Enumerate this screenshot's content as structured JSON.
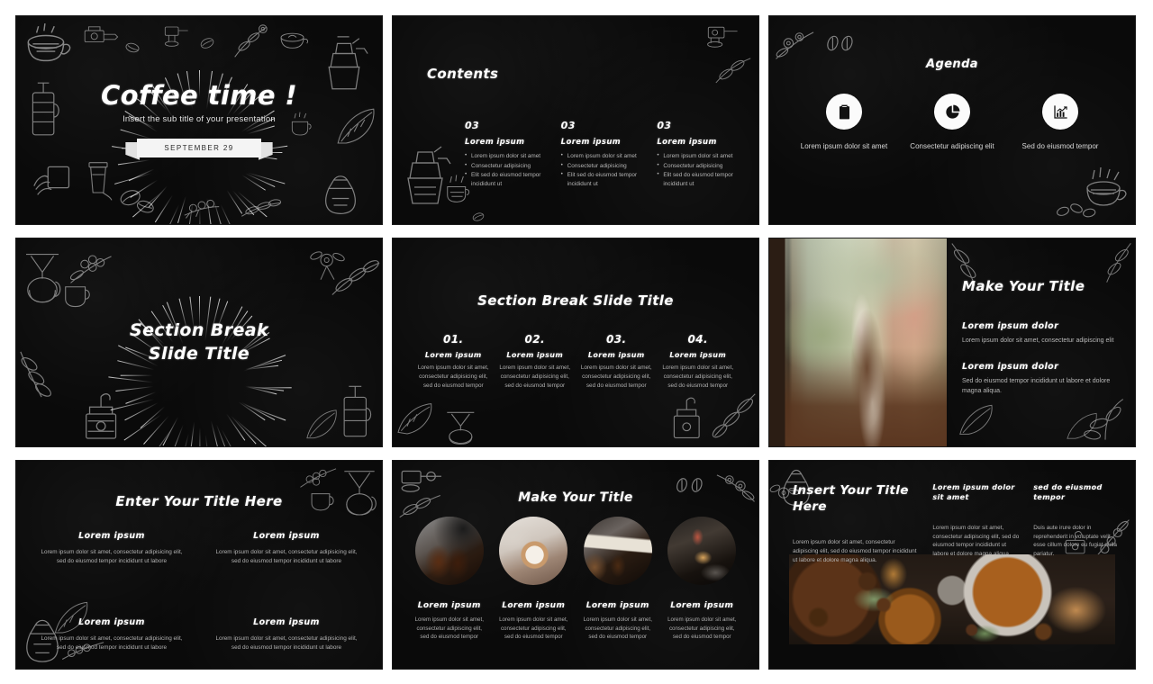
{
  "deck": {
    "theme": {
      "background": "#0a0a0a",
      "text": "#ffffff",
      "muted": "#b5b5b5",
      "accent": "#ffffff"
    }
  },
  "slide1": {
    "title": "Coffee time !",
    "subtitle": "Insert the sub title of your presentation",
    "date_badge": "SEPTEMBER 29"
  },
  "slide2": {
    "heading": "Contents",
    "columns": [
      {
        "number": "03",
        "subtitle": "Lorem ipsum",
        "bullets": [
          "Lorem ipsum dolor sit amet",
          "Consectetur adipisicing",
          "Elit sed do eiusmod tempor incididunt ut"
        ]
      },
      {
        "number": "03",
        "subtitle": "Lorem ipsum",
        "bullets": [
          "Lorem ipsum dolor sit amet",
          "Consectetur adipisicing",
          "Elit sed do eiusmod tempor incididunt ut"
        ]
      },
      {
        "number": "03",
        "subtitle": "Lorem ipsum",
        "bullets": [
          "Lorem ipsum dolor sit amet",
          "Consectetur adipisicing",
          "Elit sed do eiusmod tempor incididunt ut"
        ]
      }
    ]
  },
  "slide3": {
    "heading": "Agenda",
    "items": [
      {
        "icon": "clipboard-checklist-icon",
        "caption": "Lorem ipsum dolor sit amet"
      },
      {
        "icon": "pie-chart-icon",
        "caption": "Consectetur adipiscing elit"
      },
      {
        "icon": "bar-chart-growth-icon",
        "caption": "Sed do eiusmod tempor"
      }
    ]
  },
  "slide4": {
    "title_line1": "Section Break",
    "title_line2": "Slide Title"
  },
  "slide5": {
    "heading": "Section Break Slide Title",
    "columns": [
      {
        "number": "01.",
        "subtitle": "Lorem ipsum",
        "text": "Lorem ipsum dolor sit amet, consectetur adipisicing elit, sed do eiusmod tempor"
      },
      {
        "number": "02.",
        "subtitle": "Lorem ipsum",
        "text": "Lorem ipsum dolor sit amet, consectetur adipisicing elit, sed do eiusmod tempor"
      },
      {
        "number": "03.",
        "subtitle": "Lorem ipsum",
        "text": "Lorem ipsum dolor sit amet, consectetur adipisicing elit, sed do eiusmod tempor"
      },
      {
        "number": "04.",
        "subtitle": "Lorem ipsum",
        "text": "Lorem ipsum dolor sit amet, consectetur adipisicing elit, sed do eiusmod tempor"
      }
    ]
  },
  "slide6": {
    "photo_alt": "woman holding coffee cup at window",
    "title": "Make Your Title",
    "blocks": [
      {
        "heading": "Lorem ipsum dolor",
        "text": "Lorem ipsum dolor sit amet, consectetur adipiscing elit"
      },
      {
        "heading": "Lorem ipsum dolor",
        "text": "Sed do eiusmod tempor incididunt ut labore et dolore magna aliqua."
      }
    ]
  },
  "slide7": {
    "heading": "Enter Your Title Here",
    "cells": [
      {
        "heading": "Lorem ipsum",
        "text": "Lorem ipsum dolor sit amet, consectetur adipisicing elit, sed do eiusmod tempor incididunt ut labore"
      },
      {
        "heading": "Lorem ipsum",
        "text": "Lorem ipsum dolor sit amet, consectetur adipisicing elit, sed do eiusmod tempor incididunt ut labore"
      },
      {
        "heading": "Lorem ipsum",
        "text": "Lorem ipsum dolor sit amet, consectetur adipisicing elit, sed do eiusmod tempor incididunt ut labore"
      },
      {
        "heading": "Lorem ipsum",
        "text": "Lorem ipsum dolor sit amet, consectetur adipisicing elit, sed do eiusmod tempor incididunt ut labore"
      }
    ]
  },
  "slide8": {
    "heading": "Make Your Title",
    "columns": [
      {
        "photo_alt": "espresso machine pouring two glasses",
        "heading": "Lorem ipsum",
        "text": "Lorem ipsum dolor sit amet, consectetur adipiscing elit, sed do eiusmod tempor"
      },
      {
        "photo_alt": "hands holding latte cup over desk",
        "heading": "Lorem ipsum",
        "text": "Lorem ipsum dolor sit amet, consectetur adipiscing elit, sed do eiusmod tempor"
      },
      {
        "photo_alt": "chemex pour over brewing",
        "heading": "Lorem ipsum",
        "text": "Lorem ipsum dolor sit amet, consectetur adipiscing elit, sed do eiusmod tempor"
      },
      {
        "photo_alt": "espresso shot pulling into glass",
        "heading": "Lorem ipsum",
        "text": "Lorem ipsum dolor sit amet, consectetur adipiscing elit, sed do eiusmod tempor"
      }
    ]
  },
  "slide9": {
    "title": "Insert Your Title Here",
    "lead": "Lorem ipsum dolor sit amet, consectetur adipiscing elit, sed do eiusmod tempor incididunt ut labore et dolore magna aliqua.",
    "columns": [
      {
        "heading": "Lorem ipsum dolor sit amet",
        "text": "Lorem ipsum dolor sit amet, consectetur adipiscing elit, sed do eiusmod tempor incididunt ut labore et dolore magna aliqua."
      },
      {
        "heading": "sed do eiusmod tempor",
        "text": "Duis aute irure dolor in reprehenderit in voluptate velit esse cillum dolore eu fugiat nulla pariatur."
      }
    ],
    "photo_alt": "roasted coffee beans and ground coffee flat lay"
  }
}
